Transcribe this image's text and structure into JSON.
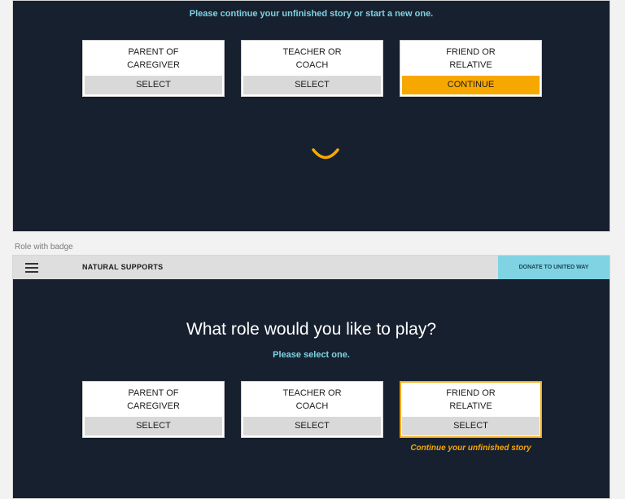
{
  "top_panel": {
    "subtitle": "Please continue your unfinished story or start a new one.",
    "cards": [
      {
        "label_line1": "PARENT OF",
        "label_line2": "CAREGIVER",
        "button": "SELECT"
      },
      {
        "label_line1": "TEACHER OR",
        "label_line2": "COACH",
        "button": "SELECT"
      },
      {
        "label_line1": "FRIEND OR",
        "label_line2": "RELATIVE",
        "button": "CONTINUE"
      }
    ]
  },
  "caption": "Role with badge",
  "bottom_panel": {
    "navbar": {
      "brand": "NATURAL SUPPORTS",
      "donate": "DONATE TO UNITED WAY"
    },
    "heading": "What role would you like to play?",
    "subtitle": "Please select one.",
    "cards": [
      {
        "label_line1": "PARENT OF",
        "label_line2": "CAREGIVER",
        "button": "SELECT"
      },
      {
        "label_line1": "TEACHER OR",
        "label_line2": "COACH",
        "button": "SELECT"
      },
      {
        "label_line1": "FRIEND OR",
        "label_line2": "RELATIVE",
        "button": "SELECT"
      }
    ],
    "continue_note": "Continue your unfinished story"
  },
  "colors": {
    "background": "#17202f",
    "accent": "#f7a800",
    "cyan": "#7fd3e3"
  }
}
